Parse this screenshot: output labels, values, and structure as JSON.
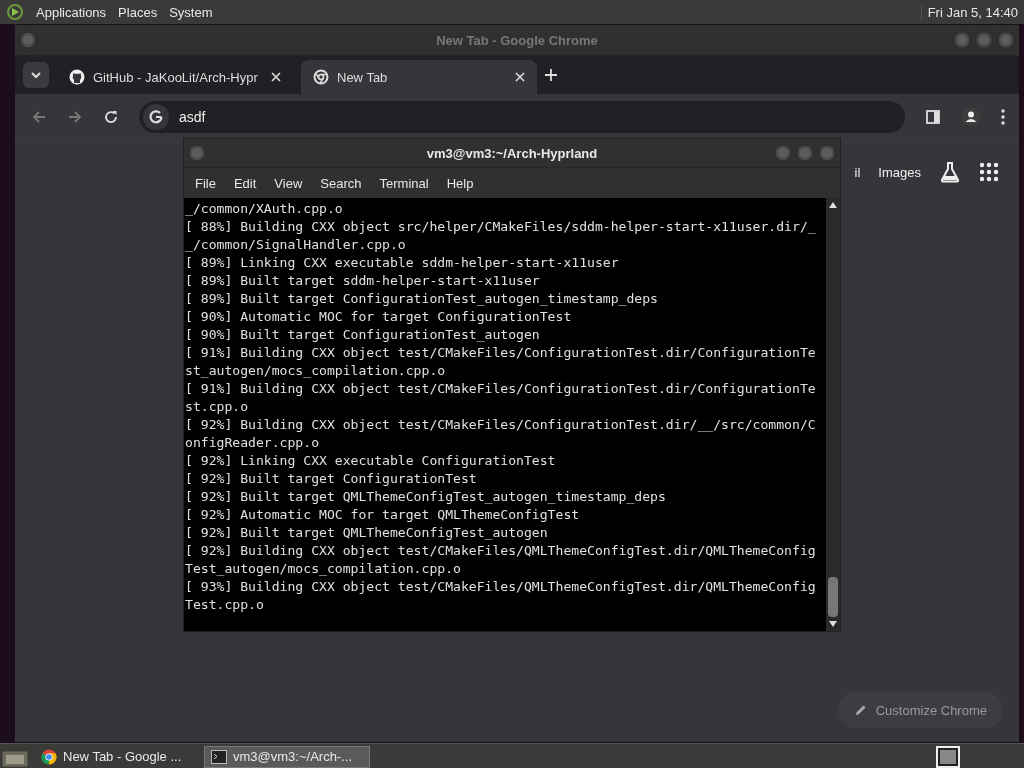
{
  "top_panel": {
    "menus": [
      "Applications",
      "Places",
      "System"
    ],
    "clock": "Fri Jan  5, 14:40"
  },
  "chrome": {
    "title": "New Tab - Google Chrome",
    "tabs": [
      {
        "label": "GitHub - JaKooLit/Arch-Hypr",
        "kind": "github",
        "selected": false
      },
      {
        "label": "New Tab",
        "kind": "chrome",
        "selected": true
      }
    ],
    "address": "asdf",
    "new_tab_links": [
      "il",
      "Images"
    ],
    "customize": "Customize Chrome"
  },
  "terminal": {
    "title": "vm3@vm3:~/Arch-Hyprland",
    "menus": [
      "File",
      "Edit",
      "View",
      "Search",
      "Terminal",
      "Help"
    ],
    "lines": [
      "_/common/XAuth.cpp.o",
      "[ 88%] Building CXX object src/helper/CMakeFiles/sddm-helper-start-x11user.dir/_",
      "_/common/SignalHandler.cpp.o",
      "[ 89%] Linking CXX executable sddm-helper-start-x11user",
      "[ 89%] Built target sddm-helper-start-x11user",
      "[ 89%] Built target ConfigurationTest_autogen_timestamp_deps",
      "[ 90%] Automatic MOC for target ConfigurationTest",
      "[ 90%] Built target ConfigurationTest_autogen",
      "[ 91%] Building CXX object test/CMakeFiles/ConfigurationTest.dir/ConfigurationTe",
      "st_autogen/mocs_compilation.cpp.o",
      "[ 91%] Building CXX object test/CMakeFiles/ConfigurationTest.dir/ConfigurationTe",
      "st.cpp.o",
      "[ 92%] Building CXX object test/CMakeFiles/ConfigurationTest.dir/__/src/common/C",
      "onfigReader.cpp.o",
      "[ 92%] Linking CXX executable ConfigurationTest",
      "[ 92%] Built target ConfigurationTest",
      "[ 92%] Built target QMLThemeConfigTest_autogen_timestamp_deps",
      "[ 92%] Automatic MOC for target QMLThemeConfigTest",
      "[ 92%] Built target QMLThemeConfigTest_autogen",
      "[ 92%] Building CXX object test/CMakeFiles/QMLThemeConfigTest.dir/QMLThemeConfig",
      "Test_autogen/mocs_compilation.cpp.o",
      "[ 93%] Building CXX object test/CMakeFiles/QMLThemeConfigTest.dir/QMLThemeConfig",
      "Test.cpp.o"
    ]
  },
  "taskbar": {
    "tasks": [
      {
        "label": "New Tab - Google ...",
        "kind": "chrome",
        "selected": false
      },
      {
        "label": "vm3@vm3:~/Arch-...",
        "kind": "terminal",
        "selected": true
      }
    ]
  }
}
